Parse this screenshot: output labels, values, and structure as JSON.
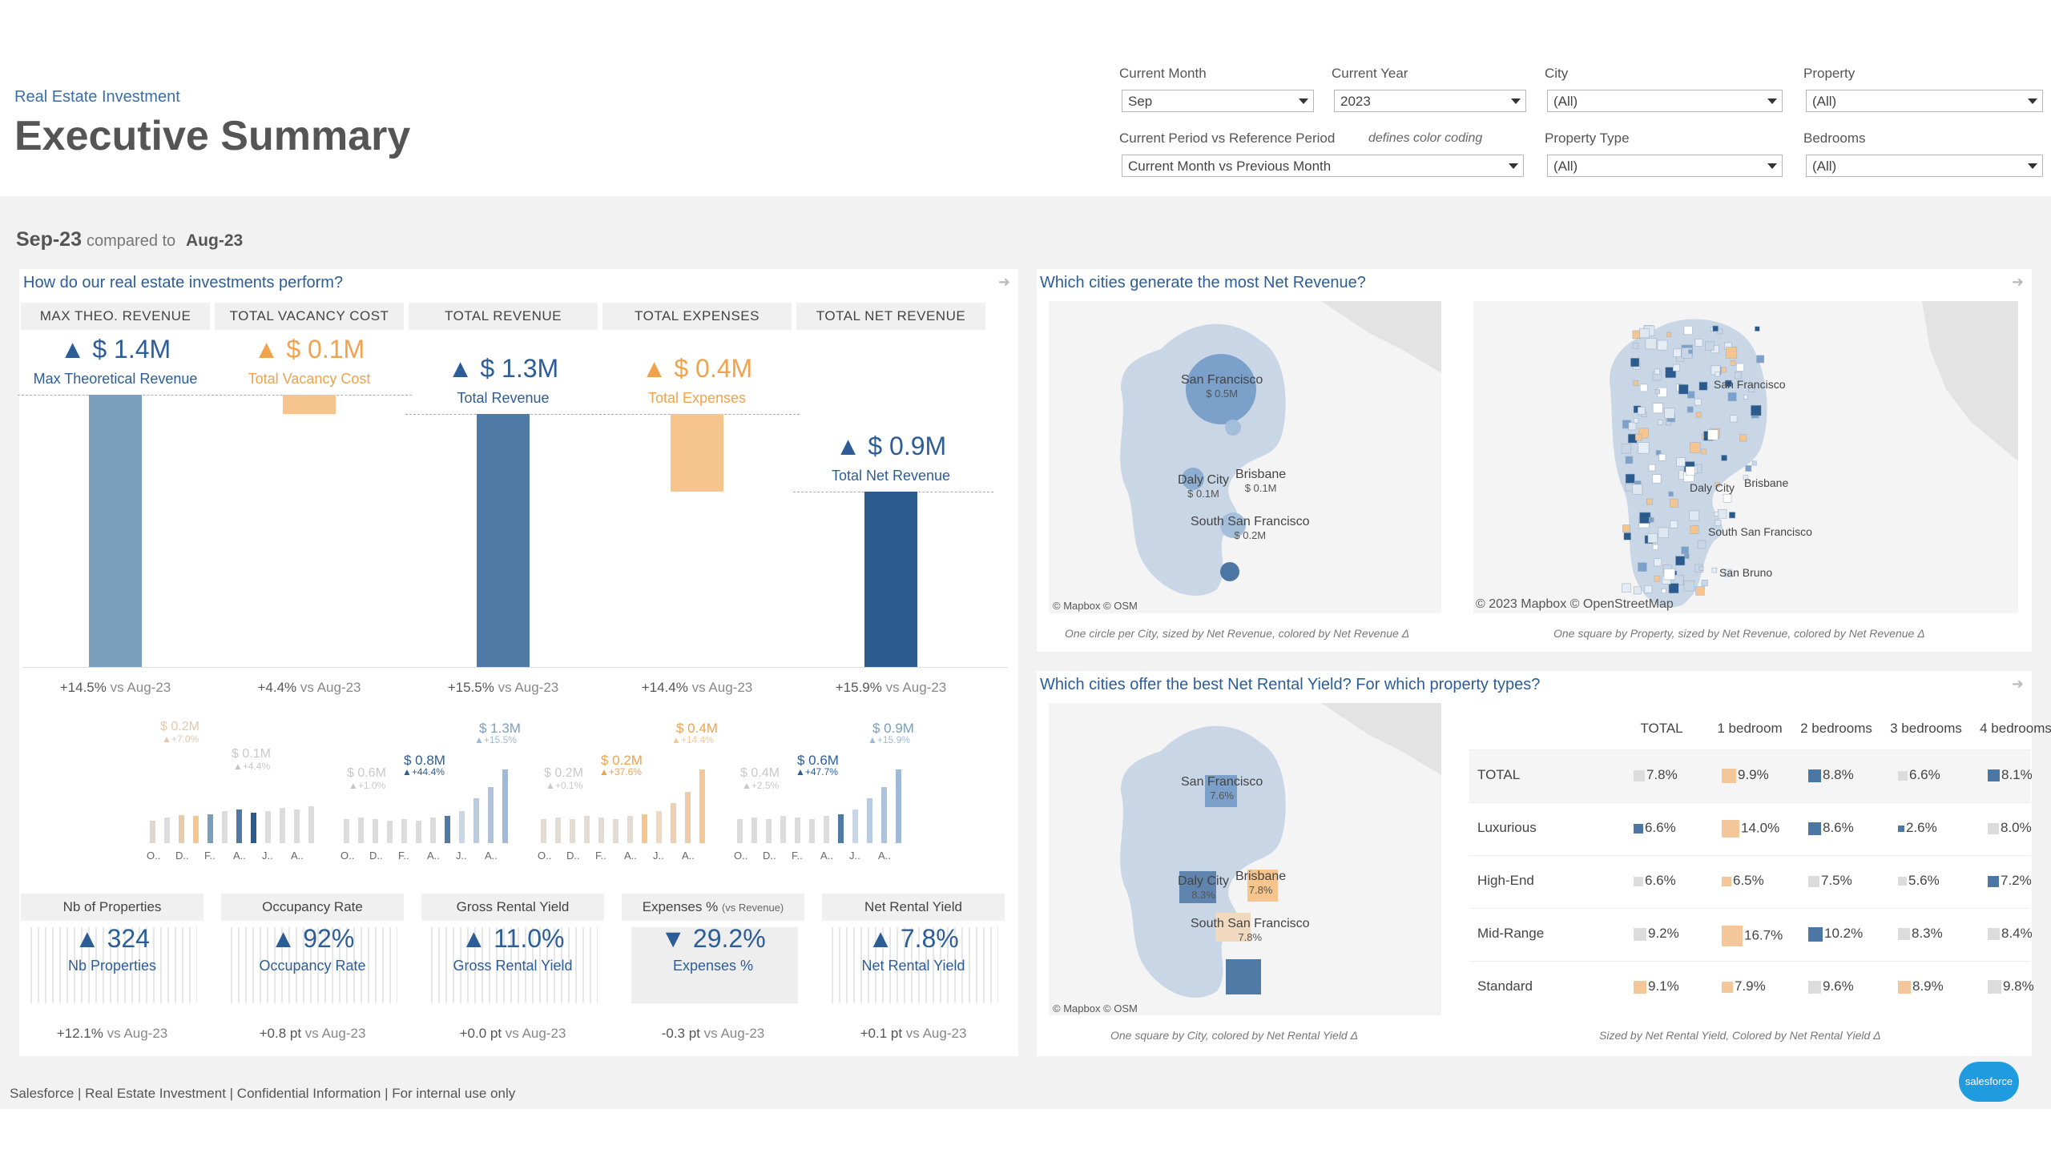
{
  "header": {
    "subtitle": "Real Estate Investment",
    "title": "Executive Summary"
  },
  "filters": {
    "current_month": {
      "label": "Current Month",
      "value": "Sep"
    },
    "current_year": {
      "label": "Current Year",
      "value": "2023"
    },
    "city": {
      "label": "City",
      "value": "(All)"
    },
    "property": {
      "label": "Property",
      "value": "(All)"
    },
    "period": {
      "label": "Current Period vs Reference Period",
      "note": "defines color coding",
      "value": "Current Month vs Previous Month"
    },
    "property_type": {
      "label": "Property Type",
      "value": "(All)"
    },
    "bedrooms": {
      "label": "Bedrooms",
      "value": "(All)"
    }
  },
  "period": {
    "current": "Sep-23",
    "compared_text": "compared to",
    "reference": "Aug-23"
  },
  "performance": {
    "title": "How do our real estate investments perform?",
    "columns": [
      {
        "header": "MAX THEO. REVENUE",
        "value": "▲ $ 1.4M",
        "label": "Max Theoretical Revenue",
        "delta": "+14.5%",
        "vs": "vs Aug-23",
        "color": "#7b9ebd",
        "orange": false
      },
      {
        "header": "TOTAL VACANCY COST",
        "value": "▲ $ 0.1M",
        "label": "Total Vacancy Cost",
        "delta": "+4.4%",
        "vs": "vs Aug-23",
        "color": "#f6c48d",
        "orange": true
      },
      {
        "header": "TOTAL REVENUE",
        "value": "▲ $ 1.3M",
        "label": "Total Revenue",
        "delta": "+15.5%",
        "vs": "vs Aug-23",
        "color": "#4f7aa6",
        "orange": false
      },
      {
        "header": "TOTAL EXPENSES",
        "value": "▲ $ 0.4M",
        "label": "Total Expenses",
        "delta": "+14.4%",
        "vs": "vs Aug-23",
        "color": "#f6c48d",
        "orange": true
      },
      {
        "header": "TOTAL NET REVENUE",
        "value": "▲ $ 0.9M",
        "label": "Total Net Revenue",
        "delta": "+15.9%",
        "vs": "vs Aug-23",
        "color": "#2b5a8c",
        "orange": false
      }
    ],
    "sparks": [
      {
        "top": "$ 0.2M",
        "top_delta": "▲+7.0%",
        "mid": "$ 0.1M",
        "mid_delta": "▲+4.4%",
        "ticks": [
          "O..",
          "D..",
          "F..",
          "A..",
          "J..",
          "A.."
        ]
      },
      {
        "top": "$ 0.6M",
        "top_delta": "▲+1.0%",
        "mid": "$ 0.8M",
        "mid_delta": "▲+44.4%",
        "extra": "$ 1.3M",
        "extra_delta": "▲+15.5%",
        "ticks": [
          "O..",
          "D..",
          "F..",
          "A..",
          "J..",
          "A.."
        ]
      },
      {
        "top": "$ 0.2M",
        "top_delta": "▲+0.1%",
        "mid": "$ 0.2M",
        "mid_delta": "▲+37.6%",
        "extra": "$ 0.4M",
        "extra_delta": "▲+14.4%",
        "ticks": [
          "O..",
          "D..",
          "F..",
          "A..",
          "J..",
          "A.."
        ]
      },
      {
        "top": "$ 0.4M",
        "top_delta": "▲+2.5%",
        "mid": "$ 0.6M",
        "mid_delta": "▲+47.7%",
        "extra": "$ 0.9M",
        "extra_delta": "▲+15.9%",
        "ticks": [
          "O..",
          "D..",
          "F..",
          "A..",
          "J..",
          "A.."
        ]
      }
    ],
    "kpis": [
      {
        "header": "Nb of Properties",
        "header_small": "",
        "value": "▲ 324",
        "label": "Nb Properties",
        "delta": "+12.1%",
        "vs": "vs Aug-23"
      },
      {
        "header": "Occupancy Rate",
        "header_small": "",
        "value": "▲ 92%",
        "label": "Occupancy Rate",
        "delta": "+0.8 pt",
        "vs": "vs Aug-23"
      },
      {
        "header": "Gross Rental Yield",
        "header_small": "",
        "value": "▲ 11.0%",
        "label": "Gross Rental Yield",
        "delta": "+0.0 pt",
        "vs": "vs Aug-23"
      },
      {
        "header": "Expenses %",
        "header_small": "(vs Revenue)",
        "value": "▼ 29.2%",
        "label": "Expenses %",
        "delta": "-0.3 pt",
        "vs": "vs Aug-23"
      },
      {
        "header": "Net Rental Yield",
        "header_small": "",
        "value": "▲ 7.8%",
        "label": "Net Rental Yield",
        "delta": "+0.1 pt",
        "vs": "vs Aug-23"
      }
    ]
  },
  "chart_data": {
    "type": "bar",
    "categories": [
      "Max Theoretical Revenue",
      "Total Vacancy Cost",
      "Total Revenue",
      "Total Expenses",
      "Total Net Revenue"
    ],
    "values": [
      1.4,
      0.1,
      1.3,
      0.4,
      0.9
    ],
    "title": "",
    "xlabel": "",
    "ylabel": "",
    "ylim": [
      0,
      1.4
    ]
  },
  "net_revenue_map": {
    "title": "Which cities generate the most Net Revenue?",
    "cities": [
      {
        "name": "San Francisco",
        "value": "$ 0.5M"
      },
      {
        "name": "Daly City",
        "value": "$ 0.1M"
      },
      {
        "name": "Brisbane",
        "value": "$ 0.1M"
      },
      {
        "name": "South San Francisco",
        "value": "$ 0.2M"
      }
    ],
    "attribution_left": "© Mapbox © OSM",
    "attribution_right": "© 2023 Mapbox © OpenStreetMap",
    "caption_left": "One circle per City, sized by Net Revenue, colored by Net Revenue Δ",
    "caption_right": "One square by Property, sized by Net Revenue, colored by Net Revenue Δ",
    "prop_labels": [
      "San Francisco",
      "Daly City",
      "Brisbane",
      "South San Francisco",
      "San Bruno"
    ]
  },
  "yield_map": {
    "title": "Which cities offer the best Net Rental Yield? For which property types?",
    "cities": [
      {
        "name": "San Francisco",
        "value": "7.6%"
      },
      {
        "name": "Daly City",
        "value": "8.3%"
      },
      {
        "name": "Brisbane",
        "value": "7.8%"
      },
      {
        "name": "South San Francisco",
        "value": "7.8%"
      }
    ],
    "attribution": "© Mapbox © OSM",
    "caption_left": "One square by City, colored by Net Rental Yield Δ",
    "caption_right": "Sized by Net Rental Yield, Colored by Net Rental Yield Δ",
    "table": {
      "columns": [
        "TOTAL",
        "1 bedroom",
        "2 bedrooms",
        "3 bedrooms",
        "4 bedrooms"
      ],
      "rows": [
        {
          "label": "TOTAL",
          "cells": [
            "7.8%",
            "9.9%",
            "8.8%",
            "6.6%",
            "8.1%"
          ],
          "colors": [
            "#dcdcdc",
            "#f3c799",
            "#4c76a3",
            "#dcdcdc",
            "#4c76a3"
          ],
          "sizes": [
            14,
            18,
            16,
            12,
            15
          ]
        },
        {
          "label": "Luxurious",
          "cells": [
            "6.6%",
            "14.0%",
            "8.6%",
            "2.6%",
            "8.0%"
          ],
          "colors": [
            "#4c76a3",
            "#f3c799",
            "#4c76a3",
            "#4c76a3",
            "#dcdcdc"
          ],
          "sizes": [
            12,
            22,
            16,
            8,
            14
          ]
        },
        {
          "label": "High-End",
          "cells": [
            "6.6%",
            "6.5%",
            "7.5%",
            "5.6%",
            "7.2%"
          ],
          "colors": [
            "#dcdcdc",
            "#f3c799",
            "#dcdcdc",
            "#dcdcdc",
            "#4c76a3"
          ],
          "sizes": [
            12,
            12,
            14,
            11,
            14
          ]
        },
        {
          "label": "Mid-Range",
          "cells": [
            "9.2%",
            "16.7%",
            "10.2%",
            "8.3%",
            "8.4%"
          ],
          "colors": [
            "#dcdcdc",
            "#f3c799",
            "#4c76a3",
            "#dcdcdc",
            "#dcdcdc"
          ],
          "sizes": [
            16,
            26,
            18,
            15,
            15
          ]
        },
        {
          "label": "Standard",
          "cells": [
            "9.1%",
            "7.9%",
            "9.6%",
            "8.9%",
            "9.8%"
          ],
          "colors": [
            "#f3c799",
            "#f3c799",
            "#dcdcdc",
            "#f3c799",
            "#dcdcdc"
          ],
          "sizes": [
            16,
            14,
            16,
            16,
            17
          ]
        }
      ]
    }
  },
  "footer": {
    "text": "Salesforce | Real Estate Investment | Confidential Information | For internal use only",
    "logo": "salesforce"
  }
}
